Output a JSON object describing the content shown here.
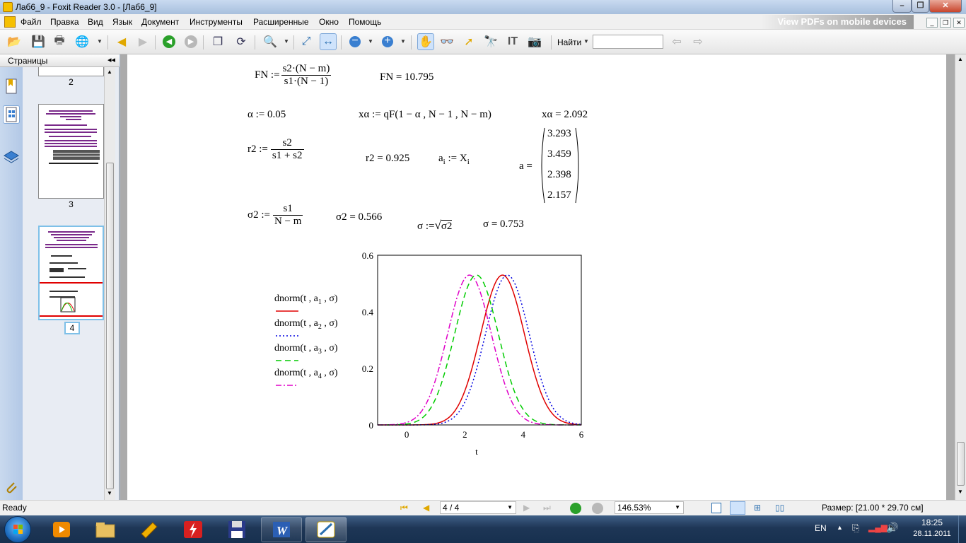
{
  "window": {
    "title": "Лаб6_9 - Foxit Reader 3.0 - [Лаб6_9]"
  },
  "menu": [
    "Файл",
    "Правка",
    "Вид",
    "Язык",
    "Документ",
    "Инструменты",
    "Расширенные",
    "Окно",
    "Помощь"
  ],
  "promo": "View PDFs on mobile devices",
  "toolbar": {
    "find_label": "Найти",
    "find_value": ""
  },
  "sidebar": {
    "header": "Страницы",
    "thumbnails": [
      {
        "page": "2"
      },
      {
        "page": "3"
      },
      {
        "page": "4",
        "selected": true
      }
    ]
  },
  "document": {
    "fn_lhs": "FN :=",
    "fn_num": "s2·(N − m)",
    "fn_den": "s1·(N − 1)",
    "fn_result": "FN = 10.795",
    "alpha_def": "α := 0.05",
    "xalpha_def": "xα := qF(1 − α , N − 1 , N − m)",
    "xalpha_result": "xα = 2.092",
    "r2_lhs": "r2 :=",
    "r2_num": "s2",
    "r2_den": "s1 + s2",
    "r2_result": "r2 = 0.925",
    "ai_def_a": "a",
    "ai_def_sub": "i",
    "ai_def_mid": " := X",
    "ai_def_sub2": "i",
    "a_lhs": "a =",
    "a_vector": [
      "3.293",
      "3.459",
      "2.398",
      "2.157"
    ],
    "s2_lhs": "σ2 :=",
    "s2_num": "s1",
    "s2_den": "N − m",
    "s2_result": "σ2 = 0.566",
    "sigma_def": "σ :=",
    "sigma_rad": "σ2",
    "sigma_result": "σ = 0.753"
  },
  "chart_data": {
    "type": "line",
    "title": "",
    "xlabel": "t",
    "ylabel": "",
    "xlim": [
      -1,
      6
    ],
    "ylim": [
      0,
      0.6
    ],
    "x_ticks": [
      "0",
      "2",
      "4",
      "6"
    ],
    "y_ticks": [
      "0",
      "0.2",
      "0.4",
      "0.6"
    ],
    "sigma": 0.753,
    "series": [
      {
        "name": "dnorm(t, a1, σ)",
        "name_pre": "dnorm(t , a",
        "name_sub": "1",
        "name_post": " , σ)",
        "mean": 3.293,
        "color": "#e00000",
        "dash": "solid"
      },
      {
        "name": "dnorm(t, a2, σ)",
        "name_pre": "dnorm(t , a",
        "name_sub": "2",
        "name_post": " , σ)",
        "mean": 3.459,
        "color": "#0000e0",
        "dash": "dot"
      },
      {
        "name": "dnorm(t, a3, σ)",
        "name_pre": "dnorm(t , a",
        "name_sub": "3",
        "name_post": " , σ)",
        "mean": 2.398,
        "color": "#00cc00",
        "dash": "dash"
      },
      {
        "name": "dnorm(t, a4, σ)",
        "name_pre": "dnorm(t , a",
        "name_sub": "4",
        "name_post": " , σ)",
        "mean": 2.157,
        "color": "#e000c8",
        "dash": "dashdot"
      }
    ]
  },
  "statusbar": {
    "ready": "Ready",
    "page_value": "4 / 4",
    "zoom_value": "146.53%",
    "size": "Размер: [21.00 * 29.70 см]"
  },
  "taskbar": {
    "lang": "EN",
    "time": "18:25",
    "date": "28.11.2011"
  },
  "colors": {
    "titlebar": "#b8cce6",
    "accent_red": "#e00000",
    "selection": "#cfe3fb"
  }
}
